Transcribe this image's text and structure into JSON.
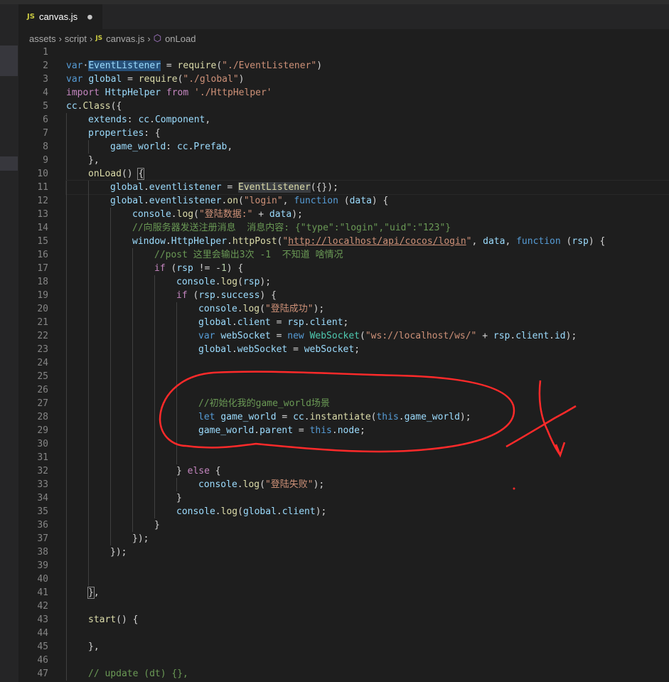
{
  "tab": {
    "badge": "JS",
    "filename": "canvas.js",
    "dirty_marker": "●"
  },
  "breadcrumb": {
    "items": [
      "assets",
      "script",
      "canvas.js",
      "onLoad"
    ],
    "separator": "›",
    "js_badge": "JS"
  },
  "colors": {
    "background": "#1e1e1e",
    "keyword": "#569cd6",
    "string": "#ce9178",
    "comment": "#6a9955",
    "variable": "#9cdcfe",
    "function": "#dcdcaa",
    "annotation": "#ff2a2a"
  },
  "annotation": {
    "description": "hand-drawn red ellipse around lines 26-30 and a red cross mark"
  },
  "lines": [
    {
      "n": "1",
      "indent": 0,
      "tokens": []
    },
    {
      "n": "2",
      "indent": 0,
      "tokens": [
        [
          "kw",
          "var"
        ],
        [
          "",
          "·"
        ],
        [
          "v hl",
          "EventListener"
        ],
        [
          "",
          " = "
        ],
        [
          "fn",
          "require"
        ],
        [
          "",
          "("
        ],
        [
          "str",
          "\"./EventListener\""
        ],
        [
          "",
          ")"
        ]
      ]
    },
    {
      "n": "3",
      "indent": 0,
      "tokens": [
        [
          "kw",
          "var"
        ],
        [
          "",
          " "
        ],
        [
          "v",
          "global"
        ],
        [
          "",
          " = "
        ],
        [
          "fn",
          "require"
        ],
        [
          "",
          "("
        ],
        [
          "str",
          "\"./global\""
        ],
        [
          "",
          ")"
        ]
      ]
    },
    {
      "n": "4",
      "indent": 0,
      "tokens": [
        [
          "kw2",
          "import"
        ],
        [
          "",
          " "
        ],
        [
          "v",
          "HttpHelper"
        ],
        [
          "",
          " "
        ],
        [
          "kw2",
          "from"
        ],
        [
          "",
          " "
        ],
        [
          "str",
          "'./HttpHelper'"
        ]
      ]
    },
    {
      "n": "5",
      "indent": 0,
      "tokens": [
        [
          "v",
          "cc"
        ],
        [
          "",
          "."
        ],
        [
          "fn",
          "Class"
        ],
        [
          "",
          "({"
        ]
      ]
    },
    {
      "n": "6",
      "indent": 1,
      "tokens": [
        [
          "v",
          "extends"
        ],
        [
          "",
          ": "
        ],
        [
          "v",
          "cc"
        ],
        [
          "",
          "."
        ],
        [
          "v",
          "Component"
        ],
        [
          "",
          ","
        ]
      ]
    },
    {
      "n": "7",
      "indent": 1,
      "tokens": [
        [
          "v",
          "properties"
        ],
        [
          "",
          ": {"
        ]
      ]
    },
    {
      "n": "8",
      "indent": 2,
      "tokens": [
        [
          "v",
          "game_world"
        ],
        [
          "",
          ": "
        ],
        [
          "v",
          "cc"
        ],
        [
          "",
          "."
        ],
        [
          "v",
          "Prefab"
        ],
        [
          "",
          ","
        ]
      ]
    },
    {
      "n": "9",
      "indent": 1,
      "tokens": [
        [
          "",
          "},"
        ]
      ]
    },
    {
      "n": "10",
      "indent": 1,
      "tokens": [
        [
          "fn",
          "onLoad"
        ],
        [
          "",
          "() "
        ],
        [
          "brk",
          "{"
        ]
      ]
    },
    {
      "n": "11",
      "indent": 2,
      "cur": true,
      "tokens": [
        [
          "v",
          "global"
        ],
        [
          "",
          "."
        ],
        [
          "v",
          "eventlistener"
        ],
        [
          "",
          " = "
        ],
        [
          "fn hl2",
          "EventListener"
        ],
        [
          "",
          "({});"
        ]
      ]
    },
    {
      "n": "12",
      "indent": 2,
      "tokens": [
        [
          "v",
          "global"
        ],
        [
          "",
          "."
        ],
        [
          "v",
          "eventlistener"
        ],
        [
          "",
          "."
        ],
        [
          "fn",
          "on"
        ],
        [
          "",
          "("
        ],
        [
          "str",
          "\"login\""
        ],
        [
          "",
          ", "
        ],
        [
          "kw",
          "function"
        ],
        [
          "",
          " ("
        ],
        [
          "v",
          "data"
        ],
        [
          "",
          ") {"
        ]
      ]
    },
    {
      "n": "13",
      "indent": 3,
      "tokens": [
        [
          "v",
          "console"
        ],
        [
          "",
          "."
        ],
        [
          "fn",
          "log"
        ],
        [
          "",
          "("
        ],
        [
          "str",
          "\"登陆数据:\""
        ],
        [
          "",
          " + "
        ],
        [
          "v",
          "data"
        ],
        [
          "",
          ");"
        ]
      ]
    },
    {
      "n": "14",
      "indent": 3,
      "tokens": [
        [
          "cm",
          "//向服务器发送注册消息  消息内容: {\"type\":\"login\",\"uid\":\"123\"}"
        ]
      ]
    },
    {
      "n": "15",
      "indent": 3,
      "tokens": [
        [
          "v",
          "window"
        ],
        [
          "",
          "."
        ],
        [
          "v",
          "HttpHelper"
        ],
        [
          "",
          "."
        ],
        [
          "fn",
          "httpPost"
        ],
        [
          "",
          "("
        ],
        [
          "str",
          "\""
        ],
        [
          "str link",
          "http://localhost/api/cocos/login"
        ],
        [
          "str",
          "\""
        ],
        [
          "",
          ", "
        ],
        [
          "v",
          "data"
        ],
        [
          "",
          ", "
        ],
        [
          "kw",
          "function"
        ],
        [
          "",
          " ("
        ],
        [
          "v",
          "rsp"
        ],
        [
          "",
          ") {"
        ]
      ]
    },
    {
      "n": "16",
      "indent": 4,
      "tokens": [
        [
          "cm",
          "//post 这里会输出3次 -1  不知道 啥情况"
        ]
      ]
    },
    {
      "n": "17",
      "indent": 4,
      "tokens": [
        [
          "kw2",
          "if"
        ],
        [
          "",
          " ("
        ],
        [
          "v",
          "rsp"
        ],
        [
          "",
          " != -"
        ],
        [
          "num",
          "1"
        ],
        [
          "",
          ") {"
        ]
      ]
    },
    {
      "n": "18",
      "indent": 5,
      "tokens": [
        [
          "v",
          "console"
        ],
        [
          "",
          "."
        ],
        [
          "fn",
          "log"
        ],
        [
          "",
          "("
        ],
        [
          "v",
          "rsp"
        ],
        [
          "",
          ");"
        ]
      ]
    },
    {
      "n": "19",
      "indent": 5,
      "tokens": [
        [
          "kw2",
          "if"
        ],
        [
          "",
          " ("
        ],
        [
          "v",
          "rsp"
        ],
        [
          "",
          "."
        ],
        [
          "v",
          "success"
        ],
        [
          "",
          ") {"
        ]
      ]
    },
    {
      "n": "20",
      "indent": 6,
      "tokens": [
        [
          "v",
          "console"
        ],
        [
          "",
          "."
        ],
        [
          "fn",
          "log"
        ],
        [
          "",
          "("
        ],
        [
          "str",
          "\"登陆成功\""
        ],
        [
          "",
          ");"
        ]
      ]
    },
    {
      "n": "21",
      "indent": 6,
      "tokens": [
        [
          "v",
          "global"
        ],
        [
          "",
          "."
        ],
        [
          "v",
          "client"
        ],
        [
          "",
          " = "
        ],
        [
          "v",
          "rsp"
        ],
        [
          "",
          "."
        ],
        [
          "v",
          "client"
        ],
        [
          "",
          ";"
        ]
      ]
    },
    {
      "n": "22",
      "indent": 6,
      "tokens": [
        [
          "kw",
          "var"
        ],
        [
          "",
          " "
        ],
        [
          "v",
          "webSocket"
        ],
        [
          "",
          " = "
        ],
        [
          "kw",
          "new"
        ],
        [
          "",
          " "
        ],
        [
          "cls",
          "WebSocket"
        ],
        [
          "",
          "("
        ],
        [
          "str",
          "\"ws://localhost/ws/\""
        ],
        [
          "",
          " + "
        ],
        [
          "v",
          "rsp"
        ],
        [
          "",
          "."
        ],
        [
          "v",
          "client"
        ],
        [
          "",
          "."
        ],
        [
          "v",
          "id"
        ],
        [
          "",
          ");"
        ]
      ]
    },
    {
      "n": "23",
      "indent": 6,
      "tokens": [
        [
          "v",
          "global"
        ],
        [
          "",
          "."
        ],
        [
          "v",
          "webSocket"
        ],
        [
          "",
          " = "
        ],
        [
          "v",
          "webSocket"
        ],
        [
          "",
          ";"
        ]
      ]
    },
    {
      "n": "24",
      "indent": 6,
      "tokens": []
    },
    {
      "n": "25",
      "indent": 6,
      "tokens": []
    },
    {
      "n": "26",
      "indent": 6,
      "tokens": []
    },
    {
      "n": "27",
      "indent": 6,
      "tokens": [
        [
          "cm",
          "//初始化我的game_world场景"
        ]
      ]
    },
    {
      "n": "28",
      "indent": 6,
      "tokens": [
        [
          "kw",
          "let"
        ],
        [
          "",
          " "
        ],
        [
          "v",
          "game_world"
        ],
        [
          "",
          " = "
        ],
        [
          "v",
          "cc"
        ],
        [
          "",
          "."
        ],
        [
          "fn",
          "instantiate"
        ],
        [
          "",
          "("
        ],
        [
          "kw",
          "this"
        ],
        [
          "",
          "."
        ],
        [
          "v",
          "game_world"
        ],
        [
          "",
          ");"
        ]
      ]
    },
    {
      "n": "29",
      "indent": 6,
      "tokens": [
        [
          "v",
          "game_world"
        ],
        [
          "",
          "."
        ],
        [
          "v",
          "parent"
        ],
        [
          "",
          " = "
        ],
        [
          "kw",
          "this"
        ],
        [
          "",
          "."
        ],
        [
          "v",
          "node"
        ],
        [
          "",
          ";"
        ]
      ]
    },
    {
      "n": "30",
      "indent": 6,
      "tokens": []
    },
    {
      "n": "31",
      "indent": 6,
      "tokens": []
    },
    {
      "n": "32",
      "indent": 5,
      "tokens": [
        [
          "",
          "} "
        ],
        [
          "kw2",
          "else"
        ],
        [
          "",
          " {"
        ]
      ]
    },
    {
      "n": "33",
      "indent": 6,
      "tokens": [
        [
          "v",
          "console"
        ],
        [
          "",
          "."
        ],
        [
          "fn",
          "log"
        ],
        [
          "",
          "("
        ],
        [
          "str",
          "\"登陆失败\""
        ],
        [
          "",
          ");"
        ]
      ]
    },
    {
      "n": "34",
      "indent": 5,
      "tokens": [
        [
          "",
          "}"
        ]
      ]
    },
    {
      "n": "35",
      "indent": 5,
      "tokens": [
        [
          "v",
          "console"
        ],
        [
          "",
          "."
        ],
        [
          "fn",
          "log"
        ],
        [
          "",
          "("
        ],
        [
          "v",
          "global"
        ],
        [
          "",
          "."
        ],
        [
          "v",
          "client"
        ],
        [
          "",
          ");"
        ]
      ]
    },
    {
      "n": "36",
      "indent": 4,
      "tokens": [
        [
          "",
          "}"
        ]
      ]
    },
    {
      "n": "37",
      "indent": 3,
      "tokens": [
        [
          "",
          "});"
        ]
      ]
    },
    {
      "n": "38",
      "indent": 2,
      "tokens": [
        [
          "",
          "});"
        ]
      ]
    },
    {
      "n": "39",
      "indent": 2,
      "tokens": []
    },
    {
      "n": "40",
      "indent": 2,
      "tokens": []
    },
    {
      "n": "41",
      "indent": 1,
      "tokens": [
        [
          "brk",
          "}"
        ],
        [
          "",
          ","
        ]
      ]
    },
    {
      "n": "42",
      "indent": 1,
      "tokens": []
    },
    {
      "n": "43",
      "indent": 1,
      "tokens": [
        [
          "fn",
          "start"
        ],
        [
          "",
          "() {"
        ]
      ]
    },
    {
      "n": "44",
      "indent": 1,
      "tokens": []
    },
    {
      "n": "45",
      "indent": 1,
      "tokens": [
        [
          "",
          "},"
        ]
      ]
    },
    {
      "n": "46",
      "indent": 1,
      "tokens": []
    },
    {
      "n": "47",
      "indent": 1,
      "tokens": [
        [
          "cm",
          "// update (dt) {},"
        ]
      ]
    }
  ]
}
